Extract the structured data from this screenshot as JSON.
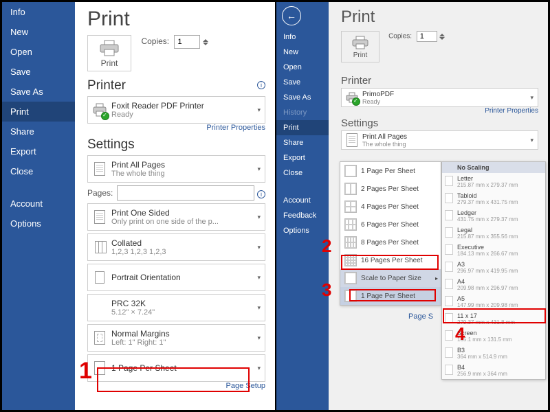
{
  "left": {
    "sidebar": [
      "Info",
      "New",
      "Open",
      "Save",
      "Save As",
      "Print",
      "Share",
      "Export",
      "Close",
      "Account",
      "Options"
    ],
    "title": "Print",
    "print_btn": "Print",
    "copies_label": "Copies:",
    "copies_value": "1",
    "printer_heading": "Printer",
    "printer_name": "Foxit Reader PDF Printer",
    "printer_status": "Ready",
    "printer_props": "Printer Properties",
    "settings_heading": "Settings",
    "dd_pages": {
      "t1": "Print All Pages",
      "t2": "The whole thing"
    },
    "pages_label": "Pages:",
    "dd_sided": {
      "t1": "Print One Sided",
      "t2": "Only print on one side of the p..."
    },
    "dd_collate": {
      "t1": "Collated",
      "t2": "1,2,3   1,2,3   1,2,3"
    },
    "dd_orient": {
      "t1": "Portrait Orientation"
    },
    "dd_paper": {
      "t1": "PRC 32K",
      "t2": "5.12\" × 7.24\""
    },
    "dd_margins": {
      "t1": "Normal Margins",
      "t2": "Left: 1\"   Right: 1\""
    },
    "dd_pps": {
      "t1": "1 Page Per Sheet"
    },
    "page_setup": "Page Setup"
  },
  "right": {
    "sidebar": [
      "Info",
      "New",
      "Open",
      "Save",
      "Save As",
      "History",
      "Print",
      "Share",
      "Export",
      "Close",
      "Account",
      "Feedback",
      "Options"
    ],
    "title": "Print",
    "print_btn": "Print",
    "copies_label": "Copies:",
    "copies_value": "1",
    "printer_heading": "Printer",
    "printer_name": "PrimoPDF",
    "printer_status": "Ready",
    "printer_props": "Printer Properties",
    "settings_heading": "Settings",
    "dd_pages": {
      "t1": "Print All Pages",
      "t2": "The whole thing"
    },
    "menu": [
      "1 Page Per Sheet",
      "2 Pages Per Sheet",
      "4 Pages Per Sheet",
      "6 Pages Per Sheet",
      "8 Pages Per Sheet",
      "16 Pages Per Sheet",
      "Scale to Paper Size",
      "1 Page Per Sheet"
    ],
    "page_setup": "Page S",
    "flyout": [
      {
        "t1": "No Scaling"
      },
      {
        "t1": "Letter",
        "t2": "215.87 mm x 279.37 mm"
      },
      {
        "t1": "Tabloid",
        "t2": "279.37 mm x 431.75 mm"
      },
      {
        "t1": "Ledger",
        "t2": "431.75 mm x 279.37 mm"
      },
      {
        "t1": "Legal",
        "t2": "215.87 mm x 355.56 mm"
      },
      {
        "t1": "Executive",
        "t2": "184.13 mm x 266.67 mm"
      },
      {
        "t1": "A3",
        "t2": "296.97 mm x 419.95 mm"
      },
      {
        "t1": "A4",
        "t2": "209.98 mm x 296.97 mm"
      },
      {
        "t1": "A5",
        "t2": "147.99 mm x 209.98 mm"
      },
      {
        "t1": "11 x 17",
        "t2": "279.37 mm x 431.8 mm"
      },
      {
        "t1": "Screen",
        "t2": "165.1 mm x 131.5 mm"
      },
      {
        "t1": "B3",
        "t2": "364 mm x 514.9 mm"
      },
      {
        "t1": "B4",
        "t2": "256.9 mm x 364 mm"
      }
    ]
  },
  "annotations": [
    "1",
    "2",
    "3",
    "4"
  ]
}
